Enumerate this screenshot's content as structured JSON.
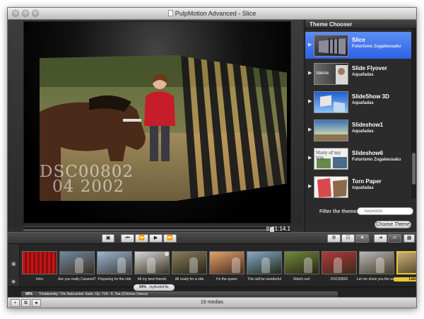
{
  "window": {
    "title": "PulpMotion Advanced - Slice"
  },
  "preview": {
    "caption_line1": "DSC00802",
    "caption_line2": "04 2002",
    "timecode": "0:01:14.1",
    "progress": 0.93
  },
  "theme_chooser": {
    "header": "Theme Chooser",
    "items": [
      {
        "name": "Slice",
        "author": "Futurismo Zugakeusaku",
        "selected": true,
        "thumb_text": ""
      },
      {
        "name": "Slide Flyover",
        "author": "Aquafadas",
        "selected": false,
        "thumb_text": "Valerie"
      },
      {
        "name": "SlideShow 3D",
        "author": "Aquafadas",
        "selected": false,
        "thumb_text": ""
      },
      {
        "name": "Slideshow1",
        "author": "Aquafadas",
        "selected": false,
        "thumb_text": ""
      },
      {
        "name": "Slideshow6",
        "author": "Futurismo Zugakeusaku",
        "selected": false,
        "thumb_text": "Story of my trip"
      },
      {
        "name": "Torn Paper",
        "author": "Aquafadas",
        "selected": false,
        "thumb_text": ""
      }
    ],
    "filter_label": "Filter the themes:",
    "search_placeholder": "keywords",
    "choose_button": "Choose Theme"
  },
  "transport": {
    "play_icon": "▶",
    "prev_icon": "⏮",
    "rewind_icon": "⏪",
    "forward_icon": "⏩"
  },
  "filmstrip": {
    "clips": [
      {
        "label": "Intro",
        "selected": false,
        "palette": [
          "#8a0d0d",
          "#c31616"
        ]
      },
      {
        "label": "Are you really Caramel?",
        "selected": false,
        "palette": [
          "#6e8aa3",
          "#3c2d1f"
        ]
      },
      {
        "label": "Preparing for the ride",
        "selected": false,
        "palette": [
          "#9cb6d1",
          "#3a3a3a"
        ]
      },
      {
        "label": "All my best friends",
        "selected": false,
        "palette": [
          "#d7d7d7",
          "#3b3324"
        ]
      },
      {
        "label": "All ready for a ride",
        "selected": false,
        "palette": [
          "#8a7c5c",
          "#2a2418"
        ]
      },
      {
        "label": "I'm the queen",
        "selected": false,
        "palette": [
          "#e0a46b",
          "#4a2a1d"
        ]
      },
      {
        "label": "This will be wonderful",
        "selected": false,
        "palette": [
          "#8aa8c8",
          "#1f2a1a"
        ]
      },
      {
        "label": "Watch out!",
        "selected": false,
        "palette": [
          "#6f8b3c",
          "#2a2413"
        ]
      },
      {
        "label": "DSC00820",
        "selected": false,
        "palette": [
          "#b2393b",
          "#3a2a1a"
        ]
      },
      {
        "label": "Let me show you the way",
        "selected": false,
        "palette": [
          "#b7b7b7",
          "#4a3b2a"
        ]
      },
      {
        "label": "Late g",
        "selected": true,
        "palette": [
          "#c9b077",
          "#4a3a22"
        ]
      }
    ]
  },
  "audio": {
    "volume_badge": "69%",
    "file_name": "myAudioFile",
    "track_percent": "99%",
    "track_title": "Tchaikovsky: The Nutcracker Suite, Op. 71A - 6. Tea (Chinese Dance)"
  },
  "status": {
    "media_count": "19 medias"
  },
  "colors": {
    "selection_blue": "#3d70ee",
    "clip_highlight": "#e7c63a"
  }
}
